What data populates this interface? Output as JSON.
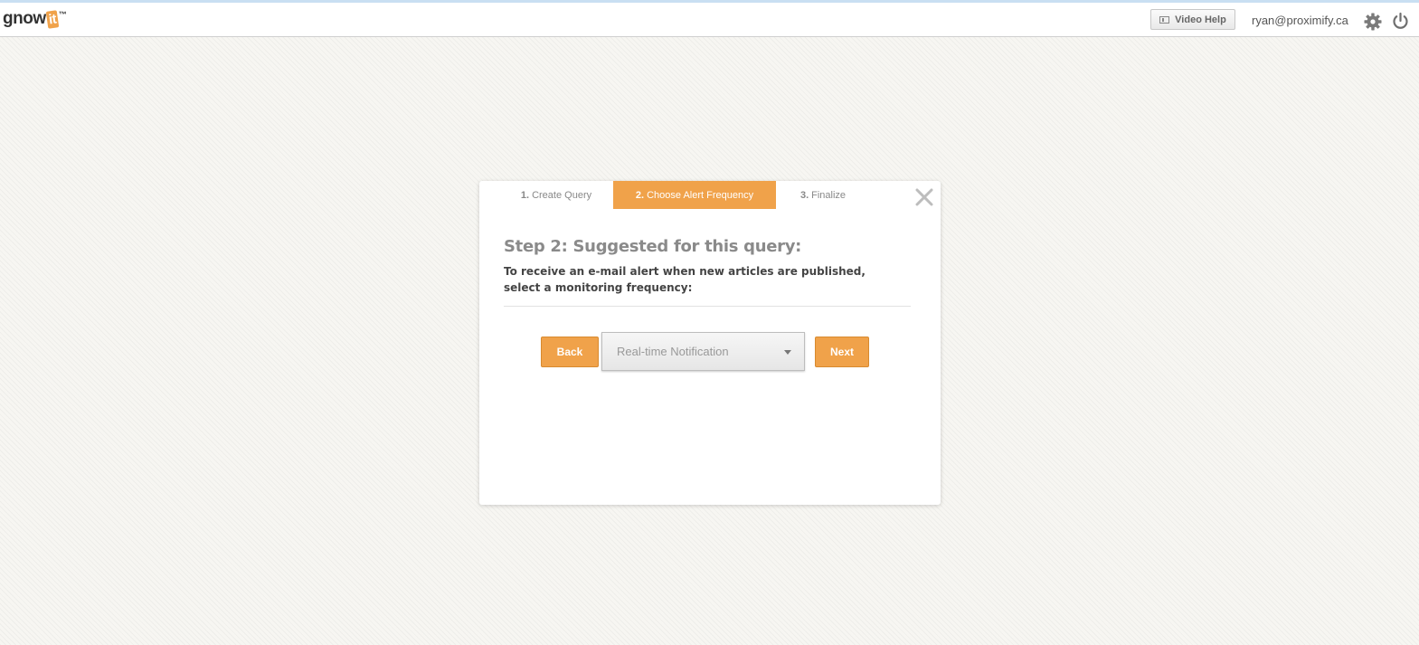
{
  "header": {
    "logo": {
      "text": "gnow",
      "highlight": "it",
      "trademark": "™"
    },
    "video_help_label": "Video Help",
    "user_email": "ryan@proximify.ca",
    "icons": [
      "video-icon",
      "gear-icon",
      "power-icon"
    ]
  },
  "modal": {
    "steps": [
      {
        "number": "1.",
        "label": "Create Query",
        "active": false
      },
      {
        "number": "2.",
        "label": "Choose Alert Frequency",
        "active": true
      },
      {
        "number": "3.",
        "label": "Finalize",
        "active": false
      }
    ],
    "title": "Step 2: Suggested for this query:",
    "description": "To receive an e-mail alert when new articles are published, select a monitoring frequency:",
    "back_label": "Back",
    "next_label": "Next",
    "frequency_select": {
      "selected": "Real-time Notification"
    },
    "close_icon": "close-icon"
  },
  "colors": {
    "accent": "#f0a24a",
    "background": "#f7f6f2",
    "header_bg": "#ffffff",
    "title_text": "#8a8a8a"
  }
}
